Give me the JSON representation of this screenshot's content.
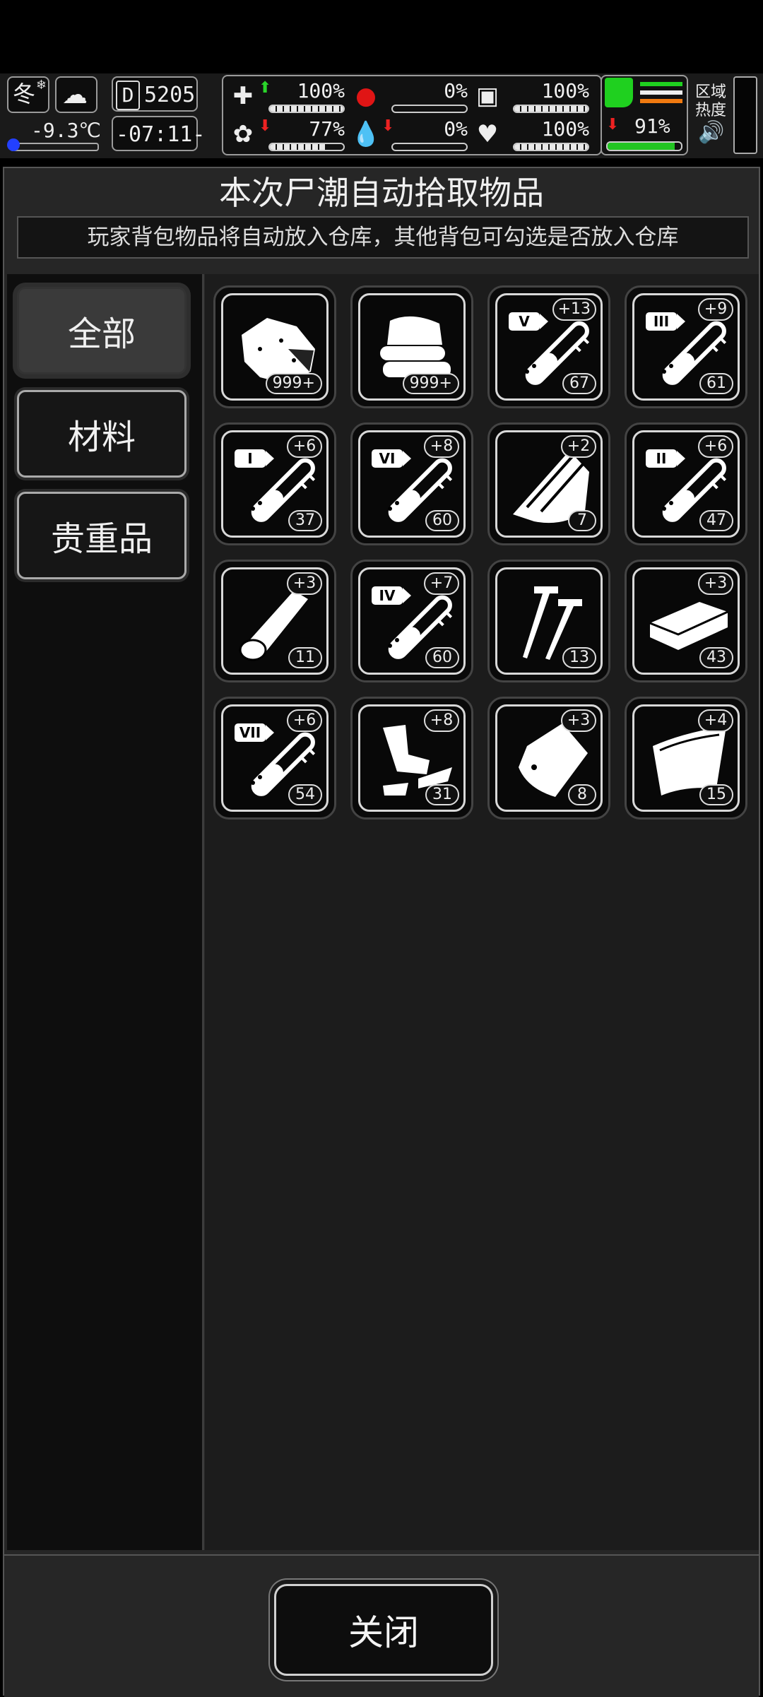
{
  "hud": {
    "season": "冬",
    "temperature": "-9.3℃",
    "day": "5205",
    "clock": "-07:11-",
    "zone_label": "区域热度",
    "stats": [
      {
        "name": "health",
        "value": "100%",
        "fill": 1.0,
        "trend": "up"
      },
      {
        "name": "hunger",
        "value": "0%",
        "fill": 0.0,
        "trend": "none"
      },
      {
        "name": "stamina",
        "value": "100%",
        "fill": 1.0,
        "trend": "none"
      },
      {
        "name": "mood",
        "value": "77%",
        "fill": 0.77,
        "trend": "down"
      },
      {
        "name": "blood",
        "value": "0%",
        "fill": 0.0,
        "trend": "down"
      },
      {
        "name": "heart",
        "value": "100%",
        "fill": 1.0,
        "trend": "none"
      },
      {
        "name": "leg",
        "value": "91%",
        "fill": 0.91,
        "trend": "down"
      }
    ]
  },
  "panel": {
    "title": "本次尸潮自动拾取物品",
    "subtitle": "玩家背包物品将自动放入仓库，其他背包可勾选是否放入仓库"
  },
  "tabs": [
    {
      "label": "全部",
      "active": true
    },
    {
      "label": "材料",
      "active": false
    },
    {
      "label": "贵重品",
      "active": false
    }
  ],
  "items": [
    {
      "icon": "cloth-scrap-icon",
      "count": "999+",
      "badge": ""
    },
    {
      "icon": "folded-cloth-icon",
      "count": "999+",
      "badge": ""
    },
    {
      "icon": "test-tube-v-icon",
      "tier": "V",
      "count": "67",
      "badge": "+13"
    },
    {
      "icon": "test-tube-iii-icon",
      "tier": "III",
      "count": "61",
      "badge": "+9"
    },
    {
      "icon": "test-tube-i-icon",
      "tier": "I",
      "count": "37",
      "badge": "+6"
    },
    {
      "icon": "test-tube-vi-icon",
      "tier": "VI",
      "count": "60",
      "badge": "+8"
    },
    {
      "icon": "wood-planks-icon",
      "count": "7",
      "badge": "+2"
    },
    {
      "icon": "test-tube-ii-icon",
      "tier": "II",
      "count": "47",
      "badge": "+6"
    },
    {
      "icon": "wood-log-icon",
      "count": "11",
      "badge": "+3"
    },
    {
      "icon": "test-tube-iv-icon",
      "tier": "IV",
      "count": "60",
      "badge": "+7"
    },
    {
      "icon": "screws-icon",
      "count": "13",
      "badge": ""
    },
    {
      "icon": "metal-bar-icon",
      "count": "43",
      "badge": "+3"
    },
    {
      "icon": "test-tube-vii-icon",
      "tier": "VII",
      "count": "54",
      "badge": "+6"
    },
    {
      "icon": "scrap-pieces-icon",
      "count": "31",
      "badge": "+8"
    },
    {
      "icon": "plastic-bag-icon",
      "count": "8",
      "badge": "+3"
    },
    {
      "icon": "metal-sheet-icon",
      "count": "15",
      "badge": "+4"
    }
  ],
  "footer": {
    "close_label": "关闭"
  }
}
